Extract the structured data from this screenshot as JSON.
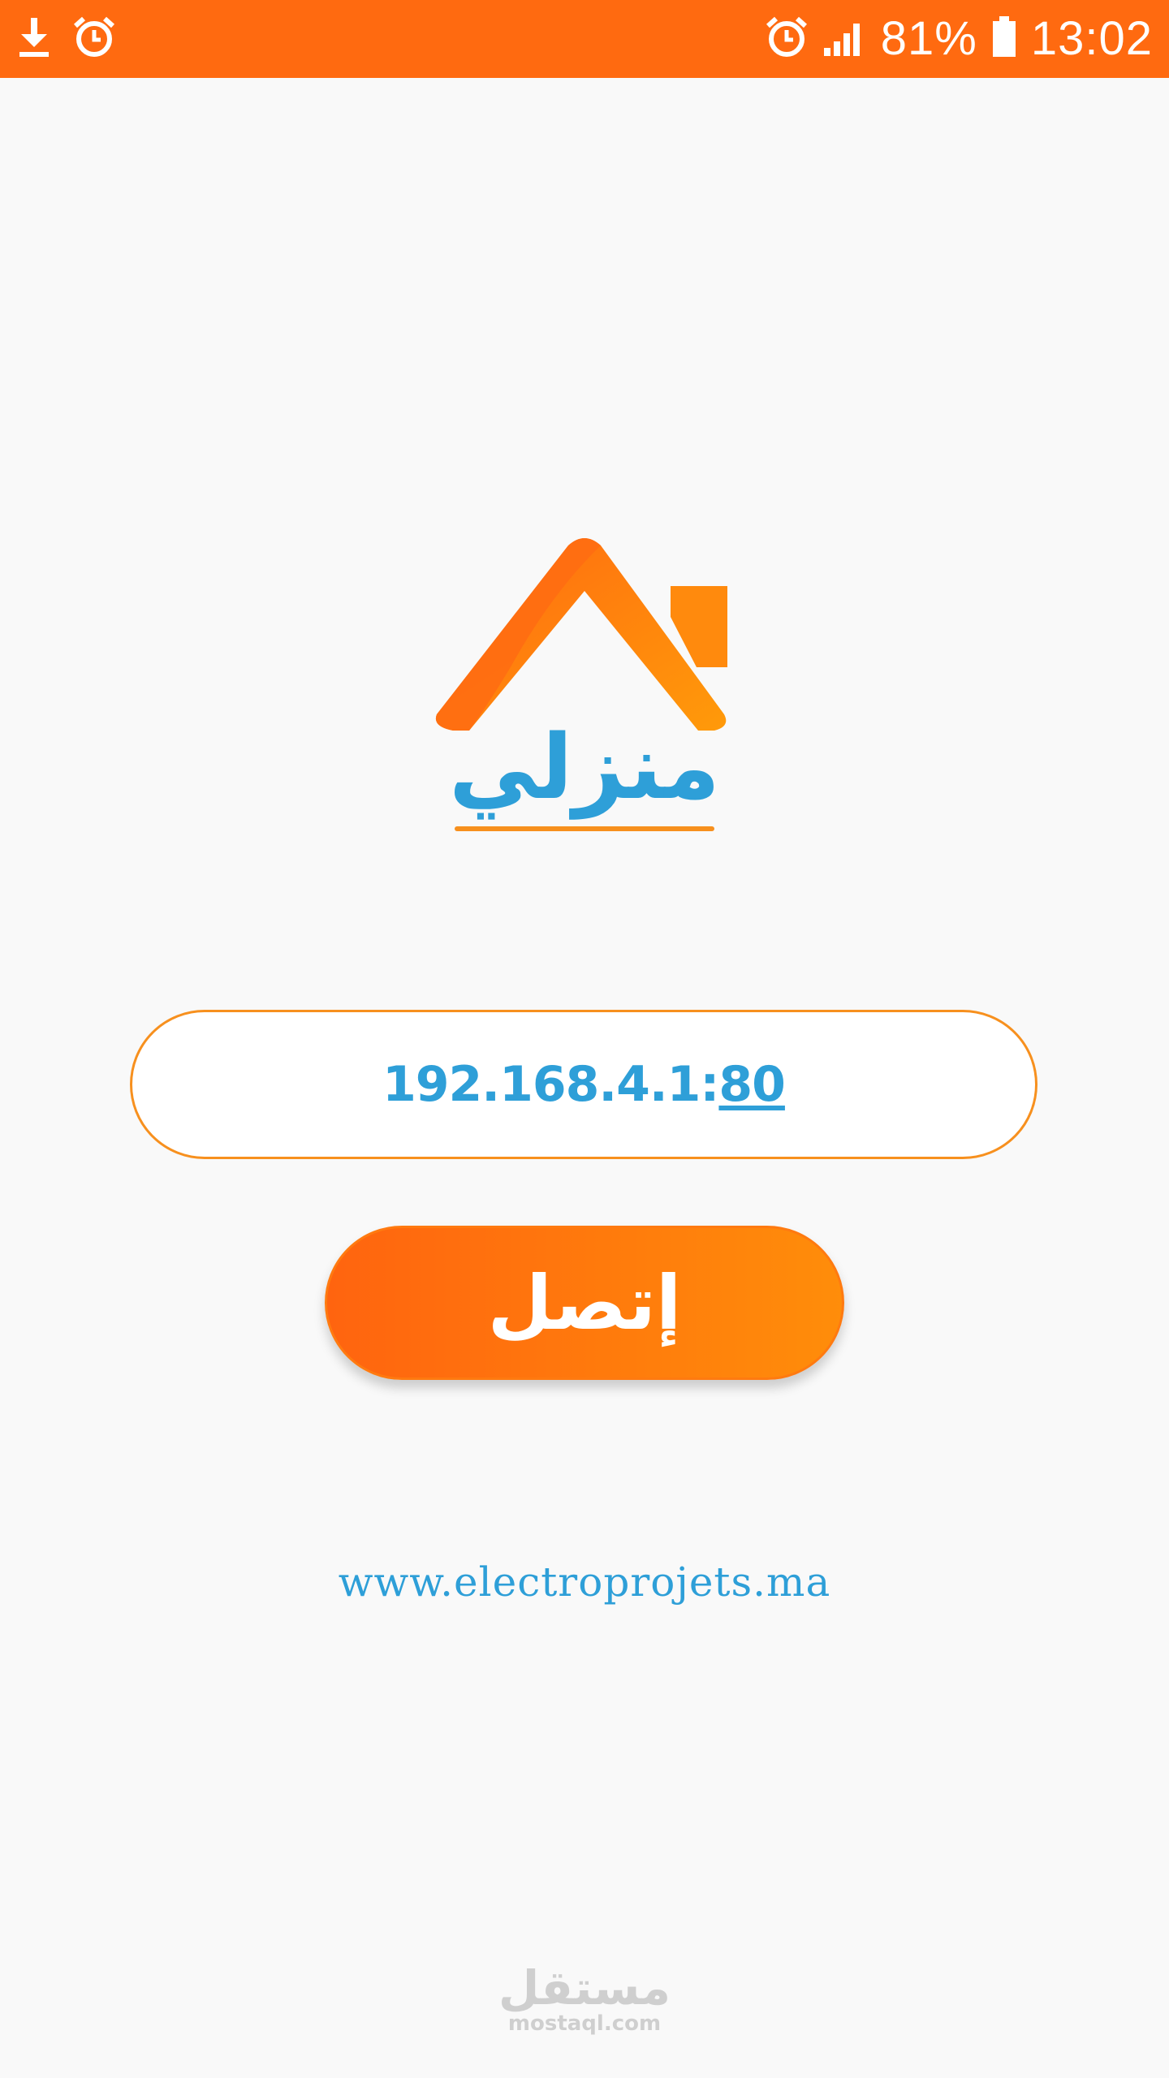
{
  "status_bar": {
    "battery": "81%",
    "time": "13:02",
    "icons_left": [
      "download-icon",
      "alarm-icon"
    ],
    "icons_right": [
      "alarm-icon",
      "signal-icon",
      "battery-icon"
    ]
  },
  "logo": {
    "text": "منزلي"
  },
  "ip_field": {
    "address": "192.168.4.1:",
    "port": "80"
  },
  "connect_button": {
    "label": "إتصل"
  },
  "website": {
    "text": "www.electroprojets.ma"
  },
  "watermark": {
    "arabic": "مستقل",
    "latin": "mostaql.com"
  },
  "colors": {
    "accent_orange": "#ff6a10",
    "text_blue": "#2e9fd8",
    "background": "#f9f9f9"
  }
}
